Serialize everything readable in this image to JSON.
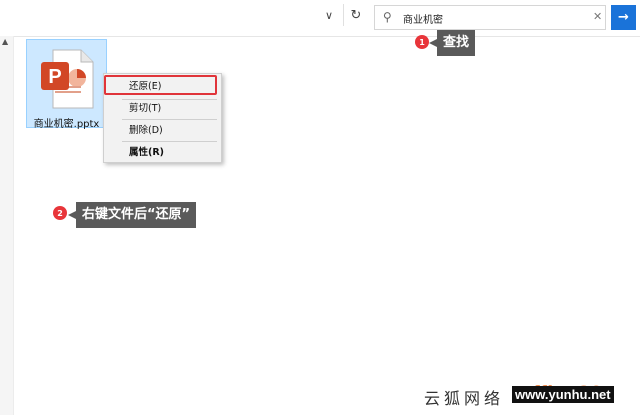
{
  "toolbar": {
    "dropdown_icon": "chevron-down-icon",
    "refresh_icon": "refresh-icon"
  },
  "search": {
    "value": "商业机密",
    "icon": "search-icon",
    "clear_icon": "close-icon",
    "go_icon": "arrow-right-icon",
    "accent": "#1a73d9"
  },
  "file": {
    "name": "商业机密.pptx",
    "icon": "powerpoint-file-icon",
    "icon_color": "#d24726",
    "selection_color": "#cde8ff"
  },
  "context_menu": {
    "items": [
      {
        "label": "还原(E)"
      },
      {
        "label": "剪切(T)"
      },
      {
        "label": "删除(D)"
      },
      {
        "label": "属性(R)"
      }
    ]
  },
  "annotations": [
    {
      "number": "1",
      "text": "查找"
    },
    {
      "number": "2",
      "text": "右键文件后“还原”"
    }
  ],
  "highlight_color": "#e0343a",
  "watermark": {
    "left_text": "云狐网络",
    "logo_text": "office26",
    "url": "www.yunhu.net"
  }
}
